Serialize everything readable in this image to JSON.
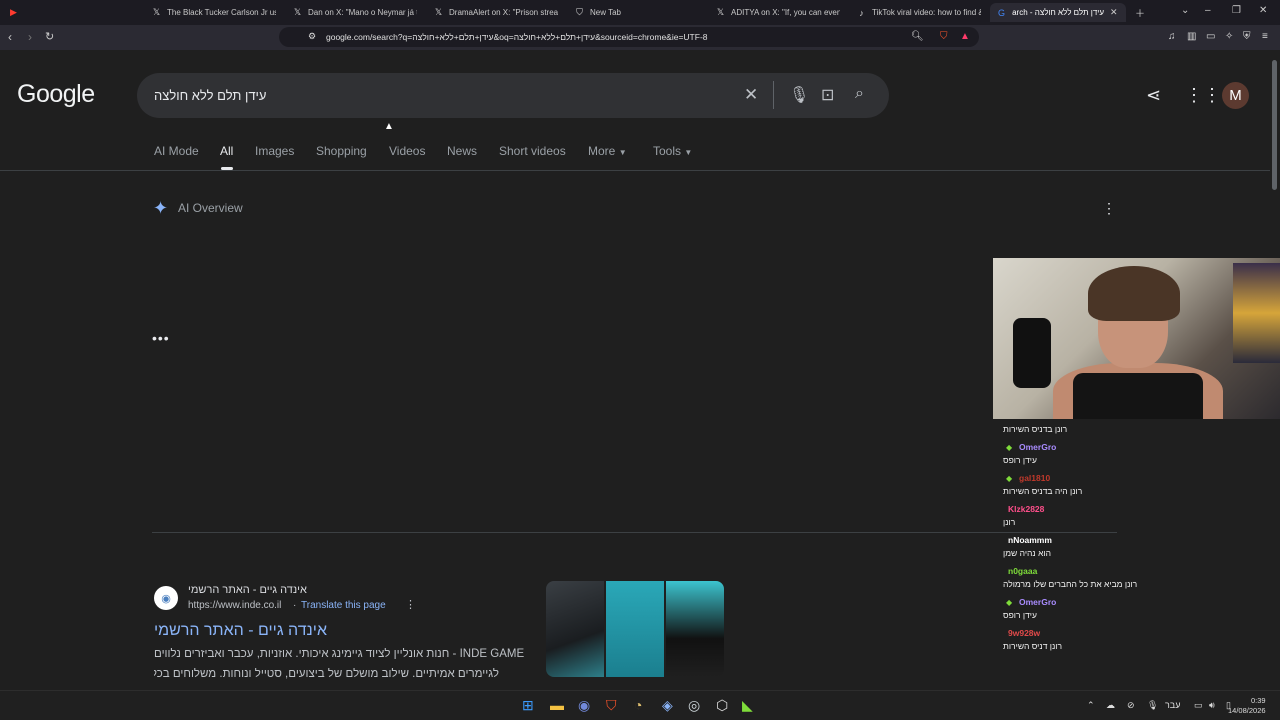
{
  "browser": {
    "tabs": [
      {
        "title": "The Black Tucker Carlson Jr us on",
        "icon": "x-icon"
      },
      {
        "title": "Dan on X: \"Mano o Neymar já te",
        "icon": "x-icon"
      },
      {
        "title": "DramaAlert on X: \"Prison stream",
        "icon": "x-icon"
      },
      {
        "title": "New Tab",
        "icon": "shield-icon"
      },
      {
        "title": "ADITYA on X: \"If, you can even w",
        "icon": "x-icon"
      },
      {
        "title": "TikTok viral video: how to find &",
        "icon": "tiktok-icon"
      },
      {
        "title": "עידן תלם ללא חולצה - Search",
        "icon": "google-icon",
        "active": true
      }
    ],
    "url": "google.com/search?q=עידן+תלם+ללא+חולצה&oq=עידן+תלם+ללא+חולצה&sourceid=chrome&ie=UTF-8"
  },
  "google": {
    "logo": "Google",
    "query": "עידן תלם ללא חולצה",
    "avatar_letter": "M",
    "tabs": [
      "AI Mode",
      "All",
      "Images",
      "Shopping",
      "Videos",
      "News",
      "Short videos",
      "More",
      "Tools"
    ],
    "ai_overview_label": "AI Overview",
    "result": {
      "site_name": "אינדה גיים - האתר הרשמי",
      "url": "https://www.inde.co.il",
      "translate": "Translate this page",
      "title": "אינדה גיים - האתר הרשמי",
      "snippet1": "INDE GAME - חנות אונליין לציוד גיימינג איכותי. אוזניות, עכבר ואביזרים נלווים",
      "snippet2": "לגיימרים אמיתיים. שילוב מושלם של ביצועים, סטייל ונוחות. משלוחים בכל"
    }
  },
  "chat": [
    {
      "user": "",
      "msg": "רונן בדניס השירות",
      "color": "#ffffff"
    },
    {
      "user": "OmerGro",
      "msg": "עידן רופס",
      "color": "#a98cff",
      "badge": true
    },
    {
      "user": "gal1810",
      "msg": "רונן היה בדניס השירות",
      "color": "#c0392b",
      "badge": true
    },
    {
      "user": "Klzk2828",
      "msg": "רונן",
      "color": "#ff4f8b"
    },
    {
      "user": "nNoammm",
      "msg": "הוא נהיה שמן",
      "color": "#ffffff"
    },
    {
      "user": "n0gaaa",
      "msg": "רונן מביא את כל החברים שלו מרמולה",
      "color": "#7fdc3a"
    },
    {
      "user": "OmerGro",
      "msg": "עידן רופס",
      "color": "#a98cff",
      "badge": true
    },
    {
      "user": "9w928w",
      "msg": "רונן דניס השירות",
      "color": "#e04a4a"
    }
  ],
  "taskbar": {
    "lang": "עבר",
    "time": "0:39",
    "date": "14/08/2026"
  }
}
